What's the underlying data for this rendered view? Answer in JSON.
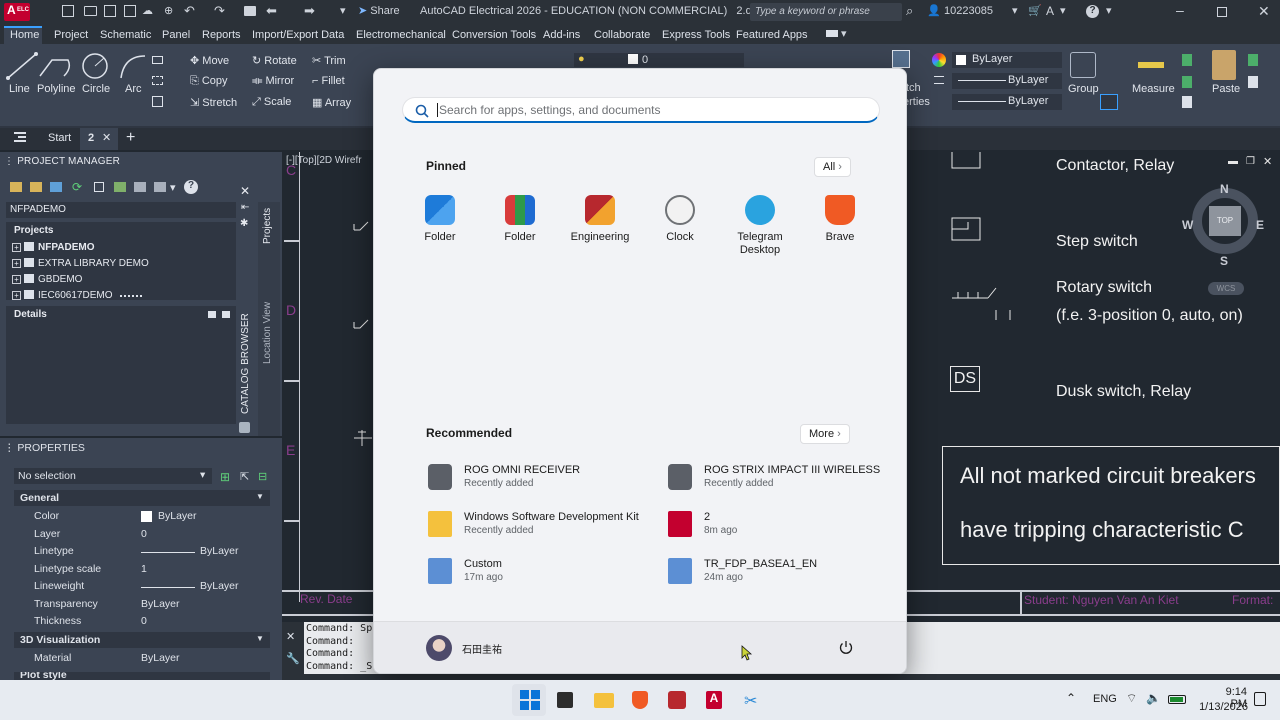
{
  "titlebar": {
    "app_badge": "A",
    "app_badge_sub": "ELC",
    "share_label": "Share",
    "title": "AutoCAD Electrical 2026 - EDUCATION (NON COMMERCIAL)   2.dwg",
    "search_placeholder": "Type a keyword or phrase",
    "user_id": "10223085"
  },
  "ribbon_tabs": [
    "Home",
    "Project",
    "Schematic",
    "Panel",
    "Reports",
    "Import/Export Data",
    "Electromechanical",
    "Conversion Tools",
    "Add-ins",
    "Collaborate",
    "Express Tools",
    "Featured Apps"
  ],
  "ribbon": {
    "line": "Line",
    "polyline": "Polyline",
    "circle": "Circle",
    "arc": "Arc",
    "move": "Move",
    "rotate": "Rotate",
    "trim": "Trim",
    "copy": "Copy",
    "mirror": "Mirror",
    "fillet": "Fillet",
    "stretch": "Stretch",
    "scale": "Scale",
    "array": "Array",
    "layer_value": "0",
    "bylayer1": "ByLayer",
    "bylayer2": "ByLayer",
    "bylayer3": "ByLayer",
    "group": "Group",
    "measure": "Measure",
    "paste": "Paste",
    "match_partial": "tch",
    "properties_partial": "erties"
  },
  "file_tabs": {
    "start": "Start",
    "current": "2"
  },
  "project_manager": {
    "title": "PROJECT MANAGER",
    "current": "NFPADEMO",
    "projects_label": "Projects",
    "projects": [
      "NFPADEMO",
      "EXTRA LIBRARY DEMO",
      "GBDEMO",
      "IEC60617DEMO"
    ],
    "details_label": "Details",
    "side_tabs": [
      "Projects",
      "Location View"
    ],
    "catalog_label": "CATALOG BROWSER"
  },
  "properties": {
    "title": "PROPERTIES",
    "selection": "No selection",
    "general_label": "General",
    "rows": [
      {
        "label": "Color",
        "value": "ByLayer"
      },
      {
        "label": "Layer",
        "value": "0"
      },
      {
        "label": "Linetype",
        "value": "ByLayer"
      },
      {
        "label": "Linetype scale",
        "value": "1"
      },
      {
        "label": "Lineweight",
        "value": "ByLayer"
      },
      {
        "label": "Transparency",
        "value": "ByLayer"
      },
      {
        "label": "Thickness",
        "value": "0"
      }
    ],
    "viz_label": "3D Visualization",
    "material_label": "Material",
    "material_value": "ByLayer",
    "plot_partial": "Plot style"
  },
  "drawing": {
    "viewport_label": "[-][Top][2D Wirefr",
    "labels": [
      "Contactor, Relay",
      "Step switch",
      "Rotary switch",
      "(f.e. 3-position 0, auto, on)",
      "Dusk switch, Relay"
    ],
    "ds_box": "DS",
    "note_line1": "All not marked circuit breakers",
    "note_line2": "have tripping characteristic C",
    "student": "Student: Nguyen Van An Kiet",
    "format_partial": "Format:",
    "rev_partial": "Rev. Date",
    "row_letters": [
      "C",
      "D",
      "E"
    ],
    "viewcube": {
      "n": "N",
      "s": "S",
      "e": "E",
      "w": "W",
      "top": "TOP",
      "wcs": "WCS"
    }
  },
  "command": {
    "lines": [
      "Command: Sp",
      "Command:",
      "Command:",
      "Command: _S"
    ]
  },
  "start_menu": {
    "search_placeholder": "Search for apps, settings, and documents",
    "pinned_label": "Pinned",
    "all_label": "All",
    "pinned": [
      {
        "label": "Folder"
      },
      {
        "label": "Folder"
      },
      {
        "label": "Engineering"
      },
      {
        "label": "Clock"
      },
      {
        "label": "Telegram Desktop"
      },
      {
        "label": "Brave"
      }
    ],
    "recommended_label": "Recommended",
    "more_label": "More",
    "recommended": [
      {
        "name": "ROG OMNI RECEIVER",
        "sub": "Recently added"
      },
      {
        "name": "ROG STRIX IMPACT III WIRELESS",
        "sub": "Recently added"
      },
      {
        "name": "Windows Software Development Kit",
        "sub": "Recently added"
      },
      {
        "name": "2",
        "sub": "8m ago"
      },
      {
        "name": "Custom",
        "sub": "17m ago"
      },
      {
        "name": "TR_FDP_BASEA1_EN",
        "sub": "24m ago"
      }
    ],
    "user_name": "石田圭祐"
  },
  "taskbar": {
    "lang": "ENG",
    "time": "9:14 PM",
    "date": "1/13/2026"
  },
  "colors": {
    "accent": "#0067c0",
    "autocad_red": "#c3002f",
    "ribbon": "#3b4453"
  }
}
